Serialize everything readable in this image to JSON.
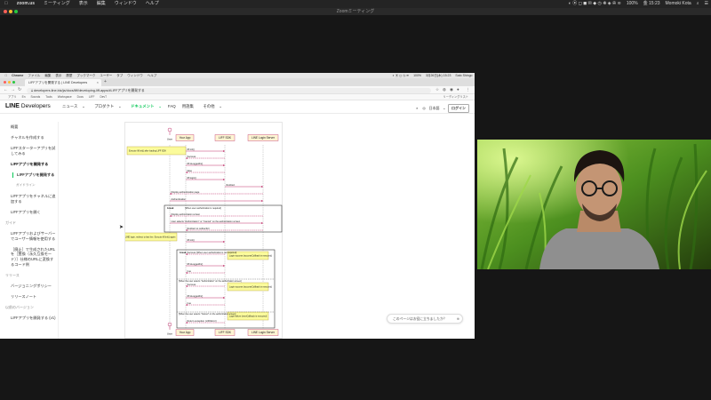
{
  "mac_menubar": {
    "app": "zoom.us",
    "items": [
      "ミーティング",
      "表示",
      "編集",
      "ウィンドウ",
      "ヘルプ"
    ],
    "right": [
      "100%",
      "金 15:23",
      "Momoki Kota"
    ]
  },
  "zoom_window": {
    "title": "Zoomミーティング"
  },
  "shared_screen": {
    "mac_menu": {
      "app": "Chrome",
      "items": [
        "ファイル",
        "編集",
        "表示",
        "履歴",
        "ブックマーク",
        "ユーザー",
        "タブ",
        "ウィンドウ",
        "ヘルプ"
      ],
      "right": [
        "100%",
        "3月26日(木) 15:23",
        "Sato Shingo"
      ]
    },
    "browser": {
      "tab_title": "LIFFアプリを開発する | LINE Developers",
      "url": "developers.line.biz/ja/docs/liff/developing-liff-apps/#LIFFアプリを開発する",
      "bookmarks": [
        "アプリ",
        "En",
        "Sounds",
        "Tools",
        "Workspace",
        "Docs",
        "LIFF",
        "DevT"
      ],
      "reading_list": "リーディングリスト"
    },
    "site": {
      "logo_line": "LINE",
      "logo_dev": "Developers",
      "nav": [
        "ニュース",
        "プロダクト",
        "ドキュメント",
        "FAQ",
        "用語集",
        "その他"
      ],
      "language": "日本語",
      "login": "ログイン",
      "sidebar": [
        {
          "label": "概要",
          "kind": "normal"
        },
        {
          "label": "チャネルを作成する",
          "kind": "normal"
        },
        {
          "label": "LIFFスターターアプリを試してみる",
          "kind": "normal"
        },
        {
          "label": "LIFFアプリを開発する",
          "kind": "bold"
        },
        {
          "label": "LIFFアプリを開発する",
          "kind": "subactive"
        },
        {
          "label": "ガイドライン",
          "kind": "ghost"
        },
        {
          "label": "LIFFアプリをチャネルに追加する",
          "kind": "normal"
        },
        {
          "label": "LIFFアプリを開く",
          "kind": "normal"
        },
        {
          "label": "ガイド",
          "kind": "sec"
        },
        {
          "label": "LIFFアプリおよびサーバーでユーザー情報を使用する",
          "kind": "normal"
        },
        {
          "label": "［廃止］で生成されたURLを［置換（永久互換モード）］仕様のURLに変換するコード例",
          "kind": "normal"
        },
        {
          "label": "リリース",
          "kind": "sec"
        },
        {
          "label": "バージョニングポリシー",
          "kind": "normal"
        },
        {
          "label": "リリースノート",
          "kind": "normal"
        },
        {
          "label": "以前のバージョン",
          "kind": "sec"
        },
        {
          "label": "LIFFアプリを開発する (v1)",
          "kind": "normal"
        }
      ],
      "feedback": "このページはお役に立ちましたか？"
    },
    "diagram": {
      "participants": [
        "User",
        "Your App",
        "LIFF SDK",
        "LINE Login Server"
      ],
      "messages": [
        "Execute liff.init() after loading LIFF SDK",
        "liff.init()",
        "Success",
        "liff.isLoggedIn()",
        "false",
        "liff.login()",
        "Redirect",
        "Display authentication page",
        "Authentication",
        "break",
        "[When user authorization is required]",
        "Display authorization screen",
        "User selects \"Authorization\" or \"Cancel\" on the authorization screen",
        "Redirect to redirectUri",
        "After LINE login, redirect to last line. Execute liff.init() again",
        "liff.init()",
        "break",
        "[When user authorization is not required]",
        "Success",
        "Login success (successCallback is executed)",
        "liff.isLoggedIn()",
        "true",
        "[When the user selects \"Authorization\" on the authorization screen]",
        "Success",
        "Login success (successCallback is executed)",
        "liff.isLoggedIn()",
        "true",
        "[When the user selects \"Cancel\" on the authorization screen]",
        "Return exception (LIFFError)",
        "Login failure (errorCallback is executed)",
        "User"
      ]
    }
  },
  "colors": {
    "line_green": "#06c755",
    "zoom_dark": "#161616",
    "diagram_lifeline_header": "#fdf4d2",
    "diagram_arrow": "#c0306b",
    "diagram_note": "#fbfb9b"
  }
}
